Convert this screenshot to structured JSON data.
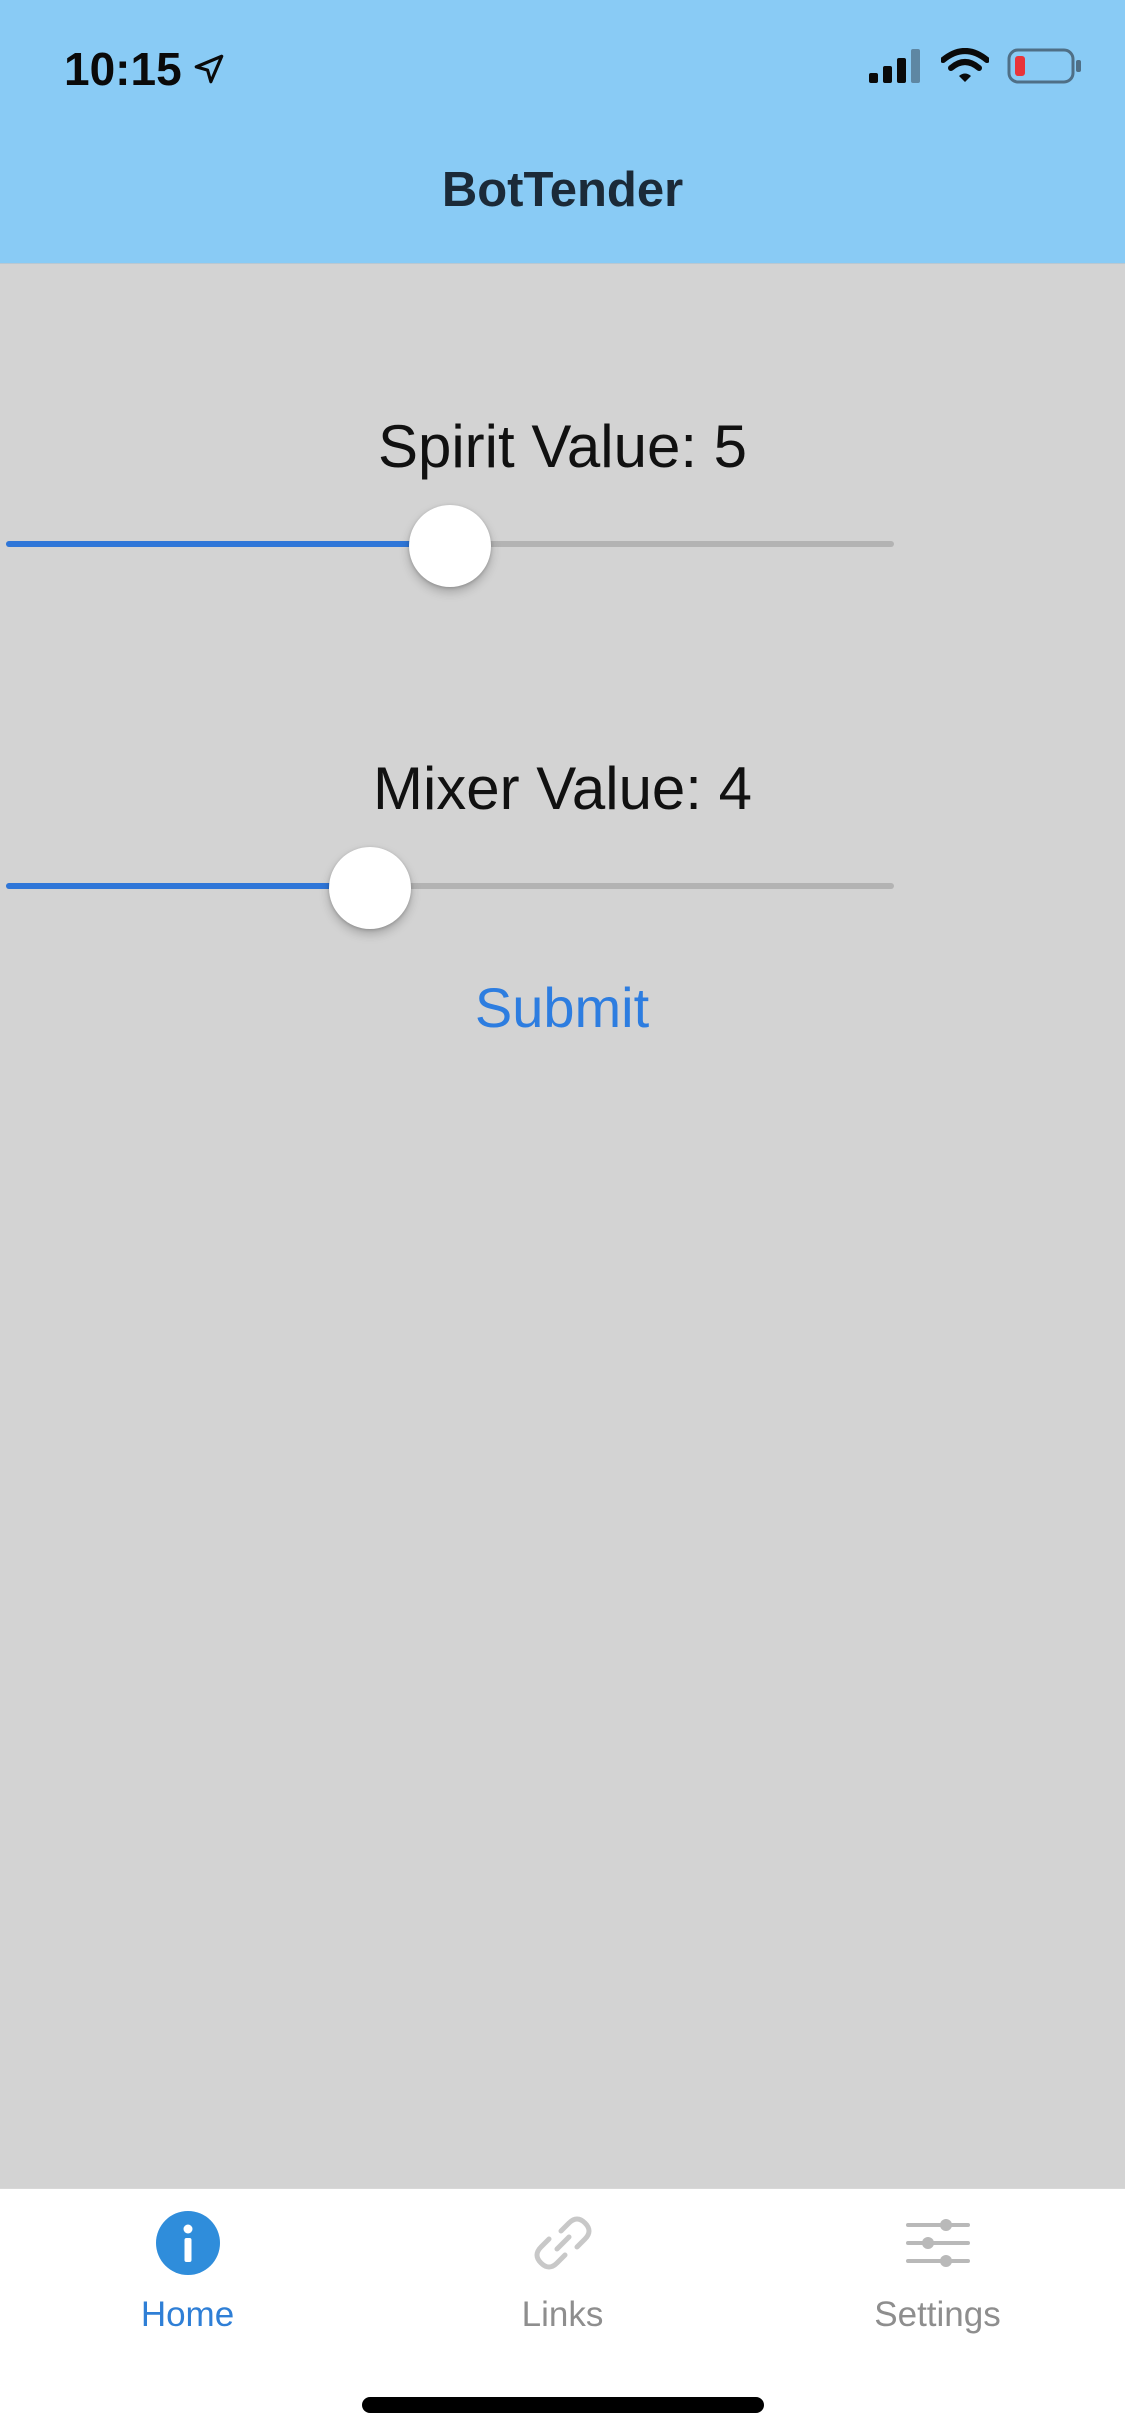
{
  "status_bar": {
    "time": "10:15",
    "location_icon": "location-arrow-icon",
    "signal_icon": "cellular-signal-icon",
    "wifi_icon": "wifi-icon",
    "battery_icon": "battery-low-icon"
  },
  "header": {
    "title": "BotTender",
    "background_color": "#89cbf5"
  },
  "sliders": [
    {
      "label": "Spirit Value: 5",
      "value": 5,
      "fraction": 0.5
    },
    {
      "label": "Mixer Value: 4",
      "value": 4,
      "fraction": 0.41
    }
  ],
  "submit": {
    "label": "Submit"
  },
  "tabbar": {
    "active_color": "#2f7fd6",
    "inactive_color": "#8e8e8e",
    "tabs": [
      {
        "label": "Home",
        "icon": "info-icon",
        "active": true
      },
      {
        "label": "Links",
        "icon": "link-icon",
        "active": false
      },
      {
        "label": "Settings",
        "icon": "sliders-icon",
        "active": false
      }
    ]
  }
}
